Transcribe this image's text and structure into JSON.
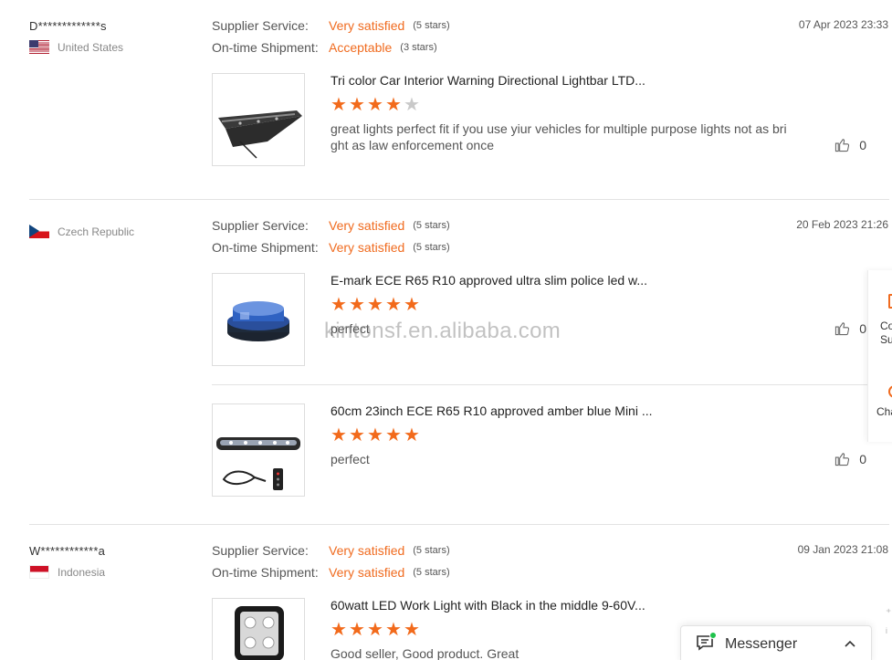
{
  "labels": {
    "supplier_service": "Supplier Service:",
    "ontime_shipment": "On-time Shipment:"
  },
  "reviews": [
    {
      "reviewer": "D*************s",
      "country": "United States",
      "supplier_service": {
        "value": "Very satisfied",
        "stars": "(5 stars)"
      },
      "ontime_shipment": {
        "value": "Acceptable",
        "stars": "(3 stars)"
      },
      "date": "07 Apr 2023 23:33",
      "products": [
        {
          "title": "Tri color Car Interior Warning Directional Lightbar LTD...",
          "rating": 4,
          "text": "great lights perfect fit if you use yiur vehicles for multiple purpose lights not as bri ght as law enforcement once",
          "likes": "0"
        }
      ]
    },
    {
      "reviewer": "",
      "country": "Czech Republic",
      "supplier_service": {
        "value": "Very satisfied",
        "stars": "(5 stars)"
      },
      "ontime_shipment": {
        "value": "Very satisfied",
        "stars": "(5 stars)"
      },
      "date": "20 Feb 2023 21:26",
      "products": [
        {
          "title": "E-mark ECE R65 R10 approved ultra slim police led w...",
          "rating": 5,
          "text": "perfect",
          "likes": "0"
        },
        {
          "title": "60cm 23inch ECE R65 R10 approved amber blue Mini ...",
          "rating": 5,
          "text": "perfect",
          "likes": "0"
        }
      ]
    },
    {
      "reviewer": "W************a",
      "country": "Indonesia",
      "supplier_service": {
        "value": "Very satisfied",
        "stars": "(5 stars)"
      },
      "ontime_shipment": {
        "value": "Very satisfied",
        "stars": "(5 stars)"
      },
      "date": "09 Jan 2023 21:08",
      "products": [
        {
          "title": "60watt LED Work Light with Black in the middle 9-60V...",
          "rating": 5,
          "text": "Good seller, Good product. Great",
          "likes": ""
        }
      ]
    }
  ],
  "watermark": "kintonsf.en.alibaba.com",
  "side_panel": {
    "item1_label": "Co Su r",
    "item2_label": "Cha"
  },
  "messenger": {
    "label": "Messenger"
  },
  "colors": {
    "accent": "#f06b1f",
    "star_on": "#f26a1b",
    "star_off": "#c9c9c9",
    "online": "#1ec24b"
  },
  "icons": {
    "like": "thumbs-up-icon",
    "messenger": "chat-icon",
    "collapse": "chevron-up-icon"
  }
}
